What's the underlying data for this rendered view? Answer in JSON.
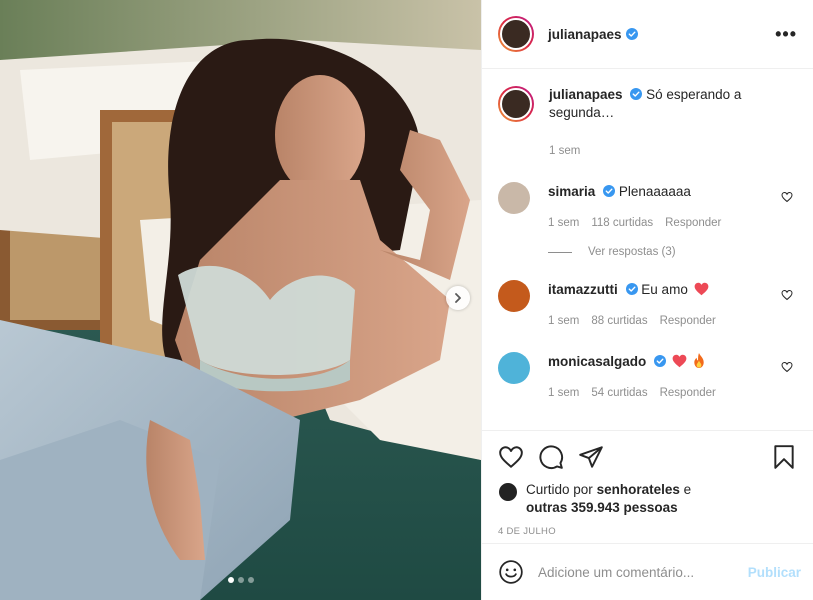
{
  "post": {
    "author": "julianapaes",
    "more_menu": "•••",
    "caption": {
      "username": "julianapaes",
      "text": "Só esperando a segunda…",
      "time": "1 sem"
    },
    "comments": [
      {
        "username": "simaria",
        "text": "Plenaaaaaa",
        "time": "1 sem",
        "likes": "118 curtidas",
        "reply": "Responder",
        "view_replies": "Ver respostas (3)",
        "avatar_color": "#c9b8a8"
      },
      {
        "username": "itamazzutti",
        "text": "Eu amo",
        "time": "1 sem",
        "likes": "88 curtidas",
        "reply": "Responder",
        "avatar_color": "#c45a1c"
      },
      {
        "username": "monicasalgado",
        "text": "",
        "time": "1 sem",
        "likes": "54 curtidas",
        "reply": "Responder",
        "avatar_color": "#4fb3d9"
      }
    ],
    "likes": {
      "prefix": "Curtido por",
      "user": "senhorateles",
      "joiner": "e",
      "others": "outras 359.943 pessoas"
    },
    "date": "4 de julho",
    "add_comment": {
      "placeholder": "Adicione um comentário...",
      "publish": "Publicar"
    },
    "carousel": {
      "slides": 3,
      "active": 0
    },
    "colors": {
      "verified": "#3897f0",
      "heart_red": "#ed4956",
      "link_disabled": "#b2dffc"
    }
  }
}
